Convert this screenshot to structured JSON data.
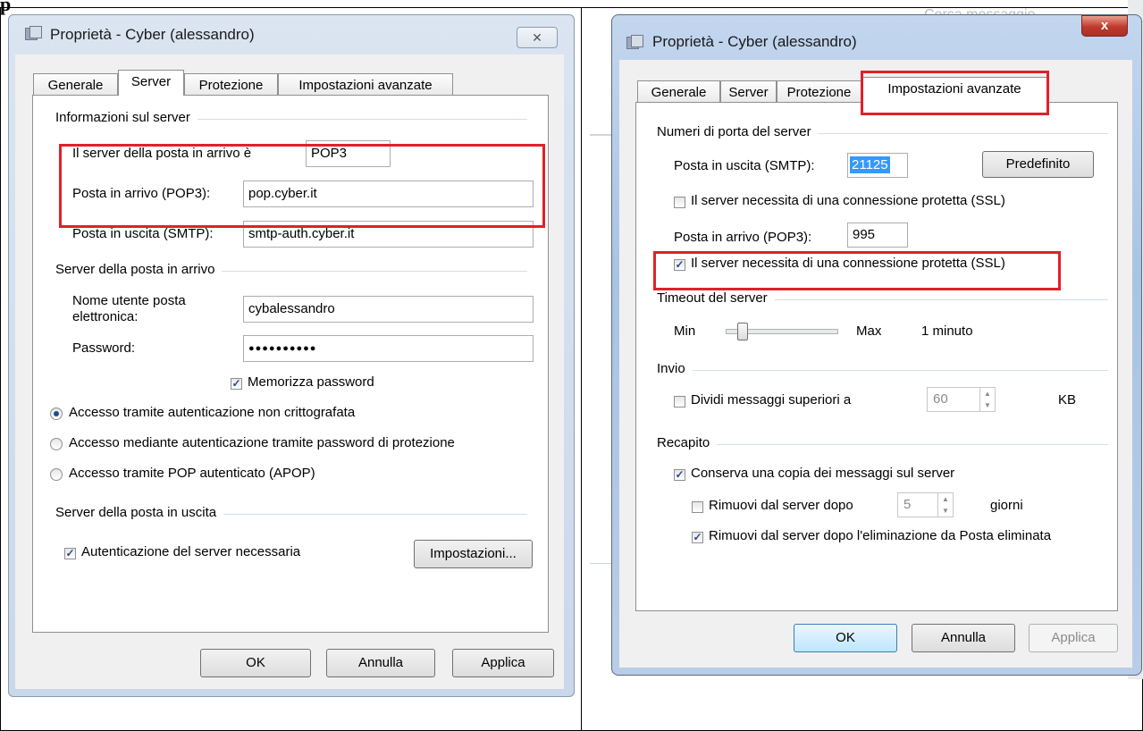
{
  "left": {
    "title": "Proprietà - Cyber (alessandro)",
    "tabs": [
      "Generale",
      "Server",
      "Protezione",
      "Impostazioni avanzate"
    ],
    "server_info_group": "Informazioni sul server",
    "incoming_type_label": "Il server della posta in arrivo è",
    "incoming_type_value": "POP3",
    "pop3_label": "Posta in arrivo (POP3):",
    "pop3_value": "pop.cyber.it",
    "smtp_label": "Posta in uscita (SMTP):",
    "smtp_value": "smtp-auth.cyber.it",
    "incoming_group": "Server della posta in arrivo",
    "username_label_1": "Nome utente posta",
    "username_label_2": "elettronica:",
    "username_value": "cybalessandro",
    "password_label": "Password:",
    "password_value": "●●●●●●●●●●",
    "remember_password": "Memorizza password",
    "radio_1": "Accesso tramite autenticazione non crittografata",
    "radio_2": "Accesso mediante autenticazione tramite password di protezione",
    "radio_3": "Accesso tramite POP autenticato (APOP)",
    "outgoing_group": "Server della posta in uscita",
    "auth_required": "Autenticazione del server necessaria",
    "settings_button": "Impostazioni...",
    "ok": "OK",
    "cancel": "Annulla",
    "apply": "Applica"
  },
  "right": {
    "title": "Proprietà - Cyber (alessandro)",
    "close_glyph": "x",
    "tabs": [
      "Generale",
      "Server",
      "Protezione",
      "Impostazioni avanzate"
    ],
    "ports_group": "Numeri di porta del server",
    "smtp_port_label": "Posta in uscita (SMTP):",
    "smtp_port_value": "21125",
    "default_button": "Predefinito",
    "ssl_smtp": "Il server necessita di una connessione protetta (SSL)",
    "pop3_port_label": "Posta in arrivo (POP3):",
    "pop3_port_value": "995",
    "ssl_pop3": "Il server necessita di una connessione protetta (SSL)",
    "timeout_group": "Timeout del server",
    "min": "Min",
    "max": "Max",
    "timeout_value": "1 minuto",
    "send_group": "Invio",
    "split_messages": "Dividi messaggi superiori a",
    "split_value": "60",
    "split_unit": "KB",
    "delivery_group": "Recapito",
    "keep_copy": "Conserva una copia dei messaggi sul server",
    "remove_after": "Rimuovi dal server dopo",
    "remove_days": "5",
    "days_unit": "giorni",
    "remove_deleted": "Rimuovi dal server dopo l'eliminazione da Posta eliminata",
    "ok": "OK",
    "cancel": "Annulla",
    "apply": "Applica"
  },
  "background": {
    "search_hint": "Cerca messaggio"
  },
  "colors": {
    "highlight": "#e0202c",
    "window_frame": "#c9d8ea",
    "dialog_bg": "#f0f0f0"
  }
}
